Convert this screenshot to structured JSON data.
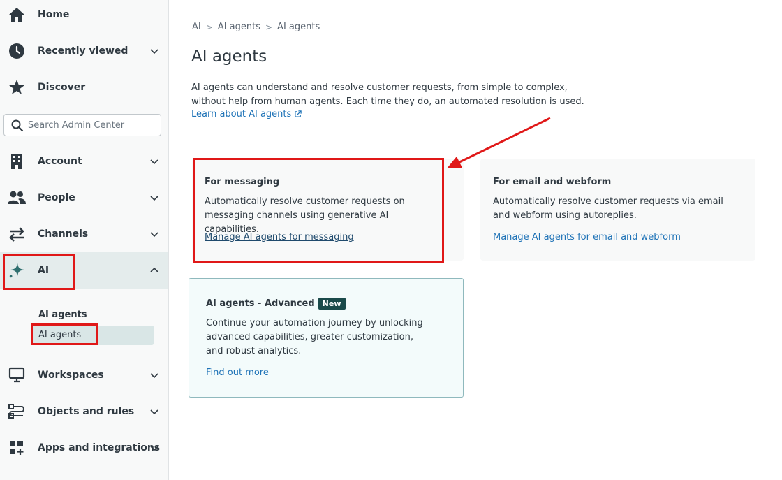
{
  "sidebar": {
    "items": [
      {
        "label": "Home",
        "icon": "home-icon"
      },
      {
        "label": "Recently viewed",
        "icon": "clock-icon"
      },
      {
        "label": "Discover",
        "icon": "star-icon"
      },
      {
        "label": "Account",
        "icon": "building-icon"
      },
      {
        "label": "People",
        "icon": "people-icon"
      },
      {
        "label": "Channels",
        "icon": "channels-icon"
      },
      {
        "label": "AI",
        "icon": "sparkle-icon"
      },
      {
        "label": "Workspaces",
        "icon": "monitor-icon"
      },
      {
        "label": "Objects and rules",
        "icon": "objects-icon"
      },
      {
        "label": "Apps and integrations",
        "icon": "apps-icon"
      }
    ],
    "search_placeholder": "Search Admin Center",
    "ai_group_label": "AI agents",
    "ai_sub_item": "AI agents"
  },
  "breadcrumb": [
    "AI",
    "AI agents",
    "AI agents"
  ],
  "page": {
    "title": "AI agents",
    "description": "AI agents can understand and resolve customer requests, from simple to complex, without help from human agents. Each time they do, an automated resolution is used.",
    "learn_link": "Learn about AI agents"
  },
  "cards": {
    "messaging": {
      "title": "For messaging",
      "description": "Automatically resolve customer requests on messaging channels using generative AI capabilities.",
      "link": "Manage AI agents for messaging"
    },
    "email": {
      "title": "For email and webform",
      "description": "Automatically resolve customer requests via email and webform using autoreplies.",
      "link": "Manage AI agents for email and webform"
    },
    "advanced": {
      "title": "AI agents - Advanced",
      "badge": "New",
      "description": "Continue your automation journey by unlocking advanced capabilities, greater customization, and robust analytics.",
      "link": "Find out more"
    }
  },
  "colors": {
    "link": "#1f73b7",
    "annotation_red": "#e01818",
    "badge_bg": "#1a4a4a",
    "active_nav_bg": "#e4ecec"
  }
}
